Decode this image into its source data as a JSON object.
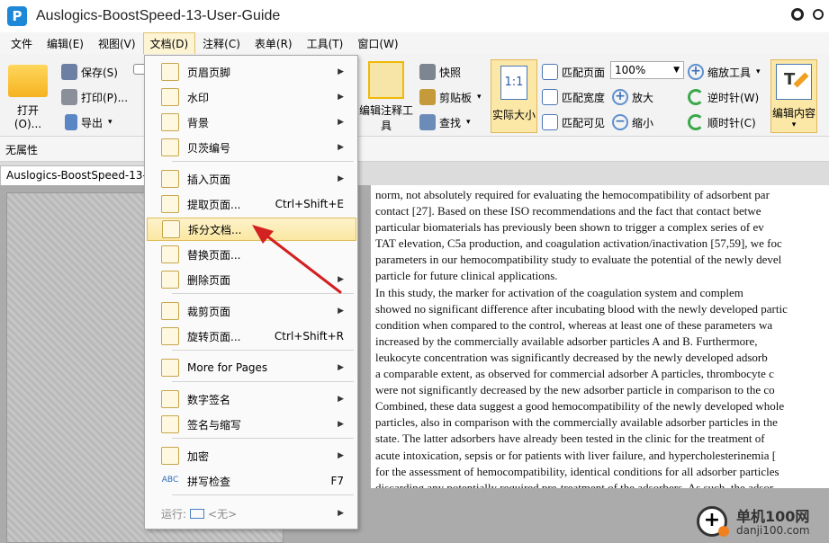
{
  "window": {
    "title": "Auslogics-BoostSpeed-13-User-Guide",
    "logo_letter": "P"
  },
  "menubar": [
    {
      "label": "文件"
    },
    {
      "label": "编辑(E)"
    },
    {
      "label": "视图(V)"
    },
    {
      "label": "文档(D)",
      "active": true
    },
    {
      "label": "注释(C)"
    },
    {
      "label": "表单(R)"
    },
    {
      "label": "工具(T)"
    },
    {
      "label": "窗口(W)"
    }
  ],
  "toolbar": {
    "open": "打开(O)...",
    "save": "保存(S)",
    "print": "打印(P)...",
    "export": "导出",
    "annotation_tool": "编辑注释工具",
    "snapshot": "快照",
    "clipboard": "剪贴板",
    "find": "查找",
    "actual_size": "实际大小",
    "actual_size_icon": "1:1",
    "fit_page": "匹配页面",
    "fit_width": "匹配宽度",
    "fit_visible": "匹配可见",
    "zoom_value": "100%",
    "zoom_in": "放大",
    "zoom_out": "缩小",
    "zoom_tool": "缩放工具",
    "rotate_ccw": "逆时针(W)",
    "rotate_cw": "顺时针(C)",
    "edit_content": "编辑内容"
  },
  "properties_bar": {
    "label": "无属性"
  },
  "doc_tab": {
    "label": "Auslogics-BoostSpeed-13-User-Guide"
  },
  "doc_menu": [
    {
      "label": "页眉页脚",
      "submenu": true,
      "icon": "header-footer-icon"
    },
    {
      "label": "水印",
      "submenu": true,
      "icon": "watermark-icon"
    },
    {
      "label": "背景",
      "submenu": true,
      "icon": "background-icon"
    },
    {
      "label": "贝茨编号",
      "submenu": true,
      "icon": "bates-number-icon"
    },
    {
      "label": "插入页面",
      "submenu": true,
      "icon": "insert-page-icon"
    },
    {
      "label": "提取页面...",
      "shortcut": "Ctrl+Shift+E",
      "icon": "extract-page-icon"
    },
    {
      "label": "拆分文档...",
      "highlighted": true,
      "icon": "split-document-icon"
    },
    {
      "label": "替换页面...",
      "icon": "replace-page-icon"
    },
    {
      "label": "删除页面",
      "submenu": true,
      "icon": "delete-page-icon"
    },
    {
      "label": "裁剪页面",
      "submenu": true,
      "icon": "crop-page-icon"
    },
    {
      "label": "旋转页面...",
      "shortcut": "Ctrl+Shift+R",
      "icon": "rotate-page-icon"
    },
    {
      "label": "More for Pages",
      "submenu": true,
      "icon": "more-pages-icon"
    },
    {
      "label": "数字签名",
      "submenu": true,
      "icon": "digital-signature-icon"
    },
    {
      "label": "签名与缩写",
      "submenu": true,
      "icon": "sign-initials-icon"
    },
    {
      "label": "加密",
      "submenu": true,
      "icon": "encrypt-icon"
    },
    {
      "label": "拼写检查",
      "shortcut": "F7",
      "icon": "spell-check-icon",
      "icon_text": "ABC"
    },
    {
      "label": "运行:",
      "run_value": "<无>",
      "submenu": true,
      "disabled": true
    }
  ],
  "document": {
    "lines": [
      "norm, not absolutely required for evaluating the hemocompatibility of adsorbent par",
      "contact [27].  Based on these ISO recommendations and the fact that contact betwe",
      "particular biomaterials has previously been shown to trigger a complex series of ev",
      "TAT elevation, C5a production, and coagulation activation/inactivation [57,59], we foc",
      "parameters in our hemocompatibility study to evaluate the potential of the newly devel",
      "particle for future clinical applications.",
      "     In this study, the marker for activation of the coagulation system and complem",
      "showed no significant difference after incubating blood with the newly developed partic",
      "condition when compared to the control, whereas at least one of these parameters wa",
      "increased by the commercially available adsorber particles A and B. Furthermore,",
      "leukocyte concentration was significantly decreased by the newly developed adsorb",
      "a comparable extent, as observed for commercial adsorber A particles, thrombocyte c",
      "were not significantly decreased by the new adsorber particle in comparison to the co",
      "Combined, these data suggest a good hemocompatibility of the newly developed whole",
      "particles, also in comparison with the commercially available adsorber particles in the",
      "state.  The latter adsorbers have already been tested in the clinic for the treatment of",
      "acute intoxication, sepsis or for patients with liver failure, and hypercholesterinemia [",
      "for the assessment of hemocompatibility, identical conditions for all adsorber particles",
      "discarding any potentially required pre-treatment of the adsorbers.  As such, the adsor"
    ]
  },
  "watermark": {
    "title": "单机100网",
    "url": "danji100.com",
    "symbol": "+"
  },
  "colors": {
    "highlight": "#fbe7a1",
    "arrow": "#d32020",
    "accent": "#1e88d8"
  }
}
